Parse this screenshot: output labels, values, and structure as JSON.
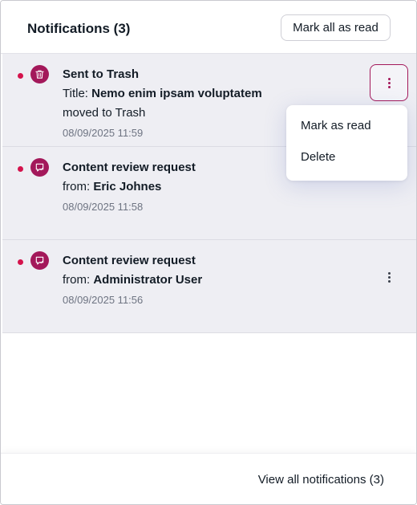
{
  "header": {
    "title": "Notifications (3)",
    "mark_all_label": "Mark all as read"
  },
  "notifications": [
    {
      "icon": "trash-icon",
      "title": "Sent to Trash",
      "line1_prefix": "Title:",
      "line1_value": "Nemo enim ipsam voluptatem",
      "line2": "moved to Trash",
      "time": "08/09/2025 11:59",
      "unread": true
    },
    {
      "icon": "review-request-icon",
      "title": "Content review request",
      "line1_prefix": "from:",
      "line1_value": "Eric Johnes",
      "time": "08/09/2025 11:58",
      "unread": true
    },
    {
      "icon": "review-request-icon",
      "title": "Content review request",
      "line1_prefix": "from:",
      "line1_value": "Administrator User",
      "time": "08/09/2025 11:56",
      "unread": true
    }
  ],
  "context_menu": {
    "items": [
      "Mark as read",
      "Delete"
    ]
  },
  "footer": {
    "view_all_label": "View all notifications",
    "view_all_count": "(3)"
  },
  "colors": {
    "accent": "#a3185a",
    "unread_dot": "#d4134c",
    "item_background": "#eeeef3"
  }
}
